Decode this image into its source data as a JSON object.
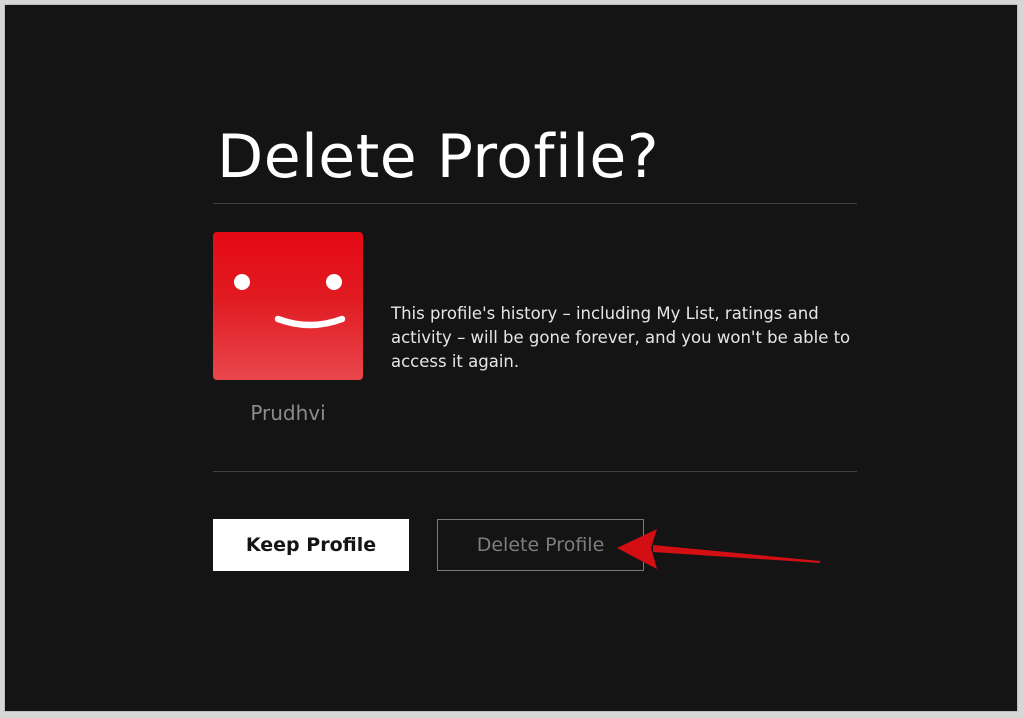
{
  "dialog": {
    "title": "Delete Profile?",
    "message": "This profile's history – including My List, ratings and activity – will be gone forever, and you won't be able to access it again.",
    "profile": {
      "name": "Prudhvi",
      "avatar_icon": "smiley-face-icon",
      "avatar_color": "#e50914"
    },
    "buttons": {
      "keep_label": "Keep Profile",
      "delete_label": "Delete Profile"
    }
  },
  "annotation": {
    "arrow_icon": "red-arrow-icon",
    "arrow_color": "#d40f14"
  }
}
